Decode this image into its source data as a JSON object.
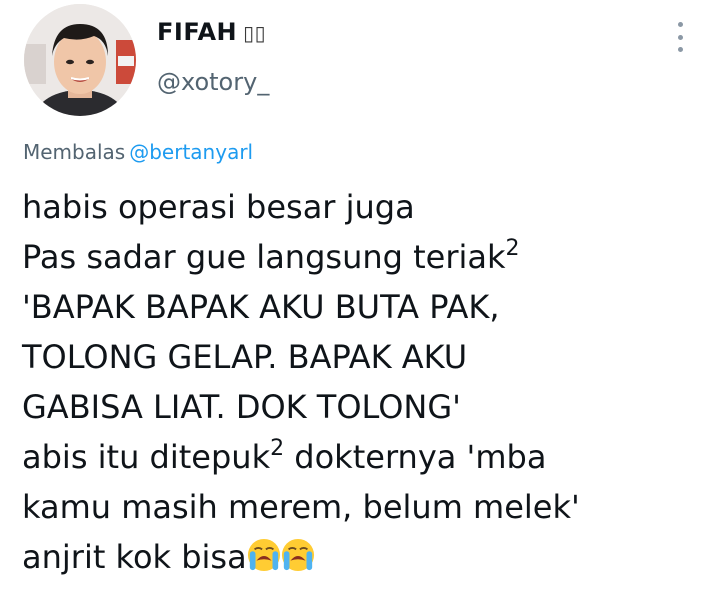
{
  "author": {
    "display_name": "FIFAH",
    "name_glyphs": "▯▯",
    "handle": "@xotory_"
  },
  "reply": {
    "prefix": "Membalas",
    "mention": "@bertanyarl"
  },
  "tweet": {
    "line1": "habis operasi besar juga",
    "line2": "Pas sadar gue langsung teriak",
    "line2_sup": "2",
    "line3": "'BAPAK BAPAK AKU BUTA PAK,",
    "line4": "TOLONG GELAP. BAPAK AKU",
    "line5": "GABISA LIAT. DOK TOLONG'",
    "line6a": "abis itu ditepuk",
    "line6_sup": "2",
    "line6b": " dokternya 'mba",
    "line7": "kamu masih merem, belum melek'",
    "line8": "anjrit kok bisa",
    "emoji": [
      "loudly-crying-face-emoji",
      "loudly-crying-face-emoji"
    ]
  },
  "colors": {
    "text": "#0f1419",
    "secondary": "#536471",
    "link": "#1d9bf0",
    "emoji_face": "#ffcc33",
    "emoji_tears": "#4fb3f0"
  },
  "icons": {
    "more": "vertical-ellipsis-icon"
  }
}
